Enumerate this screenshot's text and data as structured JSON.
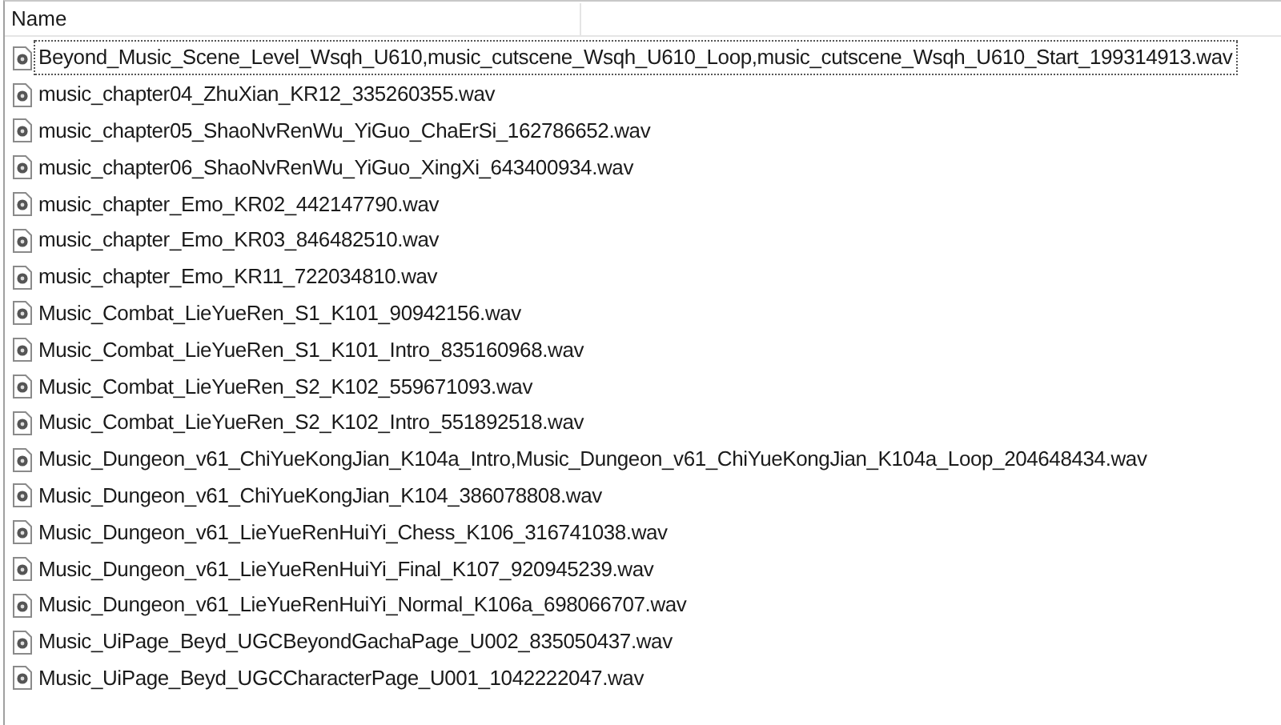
{
  "columns": [
    {
      "label": "Name"
    }
  ],
  "files": [
    {
      "name": "Beyond_Music_Scene_Level_Wsqh_U610,music_cutscene_Wsqh_U610_Loop,music_cutscene_Wsqh_U610_Start_199314913.wav",
      "focused": true
    },
    {
      "name": "music_chapter04_ZhuXian_KR12_335260355.wav",
      "focused": false
    },
    {
      "name": "music_chapter05_ShaoNvRenWu_YiGuo_ChaErSi_162786652.wav",
      "focused": false
    },
    {
      "name": "music_chapter06_ShaoNvRenWu_YiGuo_XingXi_643400934.wav",
      "focused": false
    },
    {
      "name": "music_chapter_Emo_KR02_442147790.wav",
      "focused": false
    },
    {
      "name": "music_chapter_Emo_KR03_846482510.wav",
      "focused": false
    },
    {
      "name": "music_chapter_Emo_KR11_722034810.wav",
      "focused": false
    },
    {
      "name": "Music_Combat_LieYueRen_S1_K101_90942156.wav",
      "focused": false
    },
    {
      "name": "Music_Combat_LieYueRen_S1_K101_Intro_835160968.wav",
      "focused": false
    },
    {
      "name": "Music_Combat_LieYueRen_S2_K102_559671093.wav",
      "focused": false
    },
    {
      "name": "Music_Combat_LieYueRen_S2_K102_Intro_551892518.wav",
      "focused": false
    },
    {
      "name": "Music_Dungeon_v61_ChiYueKongJian_K104a_Intro,Music_Dungeon_v61_ChiYueKongJian_K104a_Loop_204648434.wav",
      "focused": false
    },
    {
      "name": "Music_Dungeon_v61_ChiYueKongJian_K104_386078808.wav",
      "focused": false
    },
    {
      "name": "Music_Dungeon_v61_LieYueRenHuiYi_Chess_K106_316741038.wav",
      "focused": false
    },
    {
      "name": "Music_Dungeon_v61_LieYueRenHuiYi_Final_K107_920945239.wav",
      "focused": false
    },
    {
      "name": "Music_Dungeon_v61_LieYueRenHuiYi_Normal_K106a_698066707.wav",
      "focused": false
    },
    {
      "name": "Music_UiPage_Beyd_UGCBeyondGachaPage_U002_835050437.wav",
      "focused": false
    },
    {
      "name": "Music_UiPage_Beyd_UGCCharacterPage_U001_1042222047.wav",
      "focused": false
    }
  ]
}
